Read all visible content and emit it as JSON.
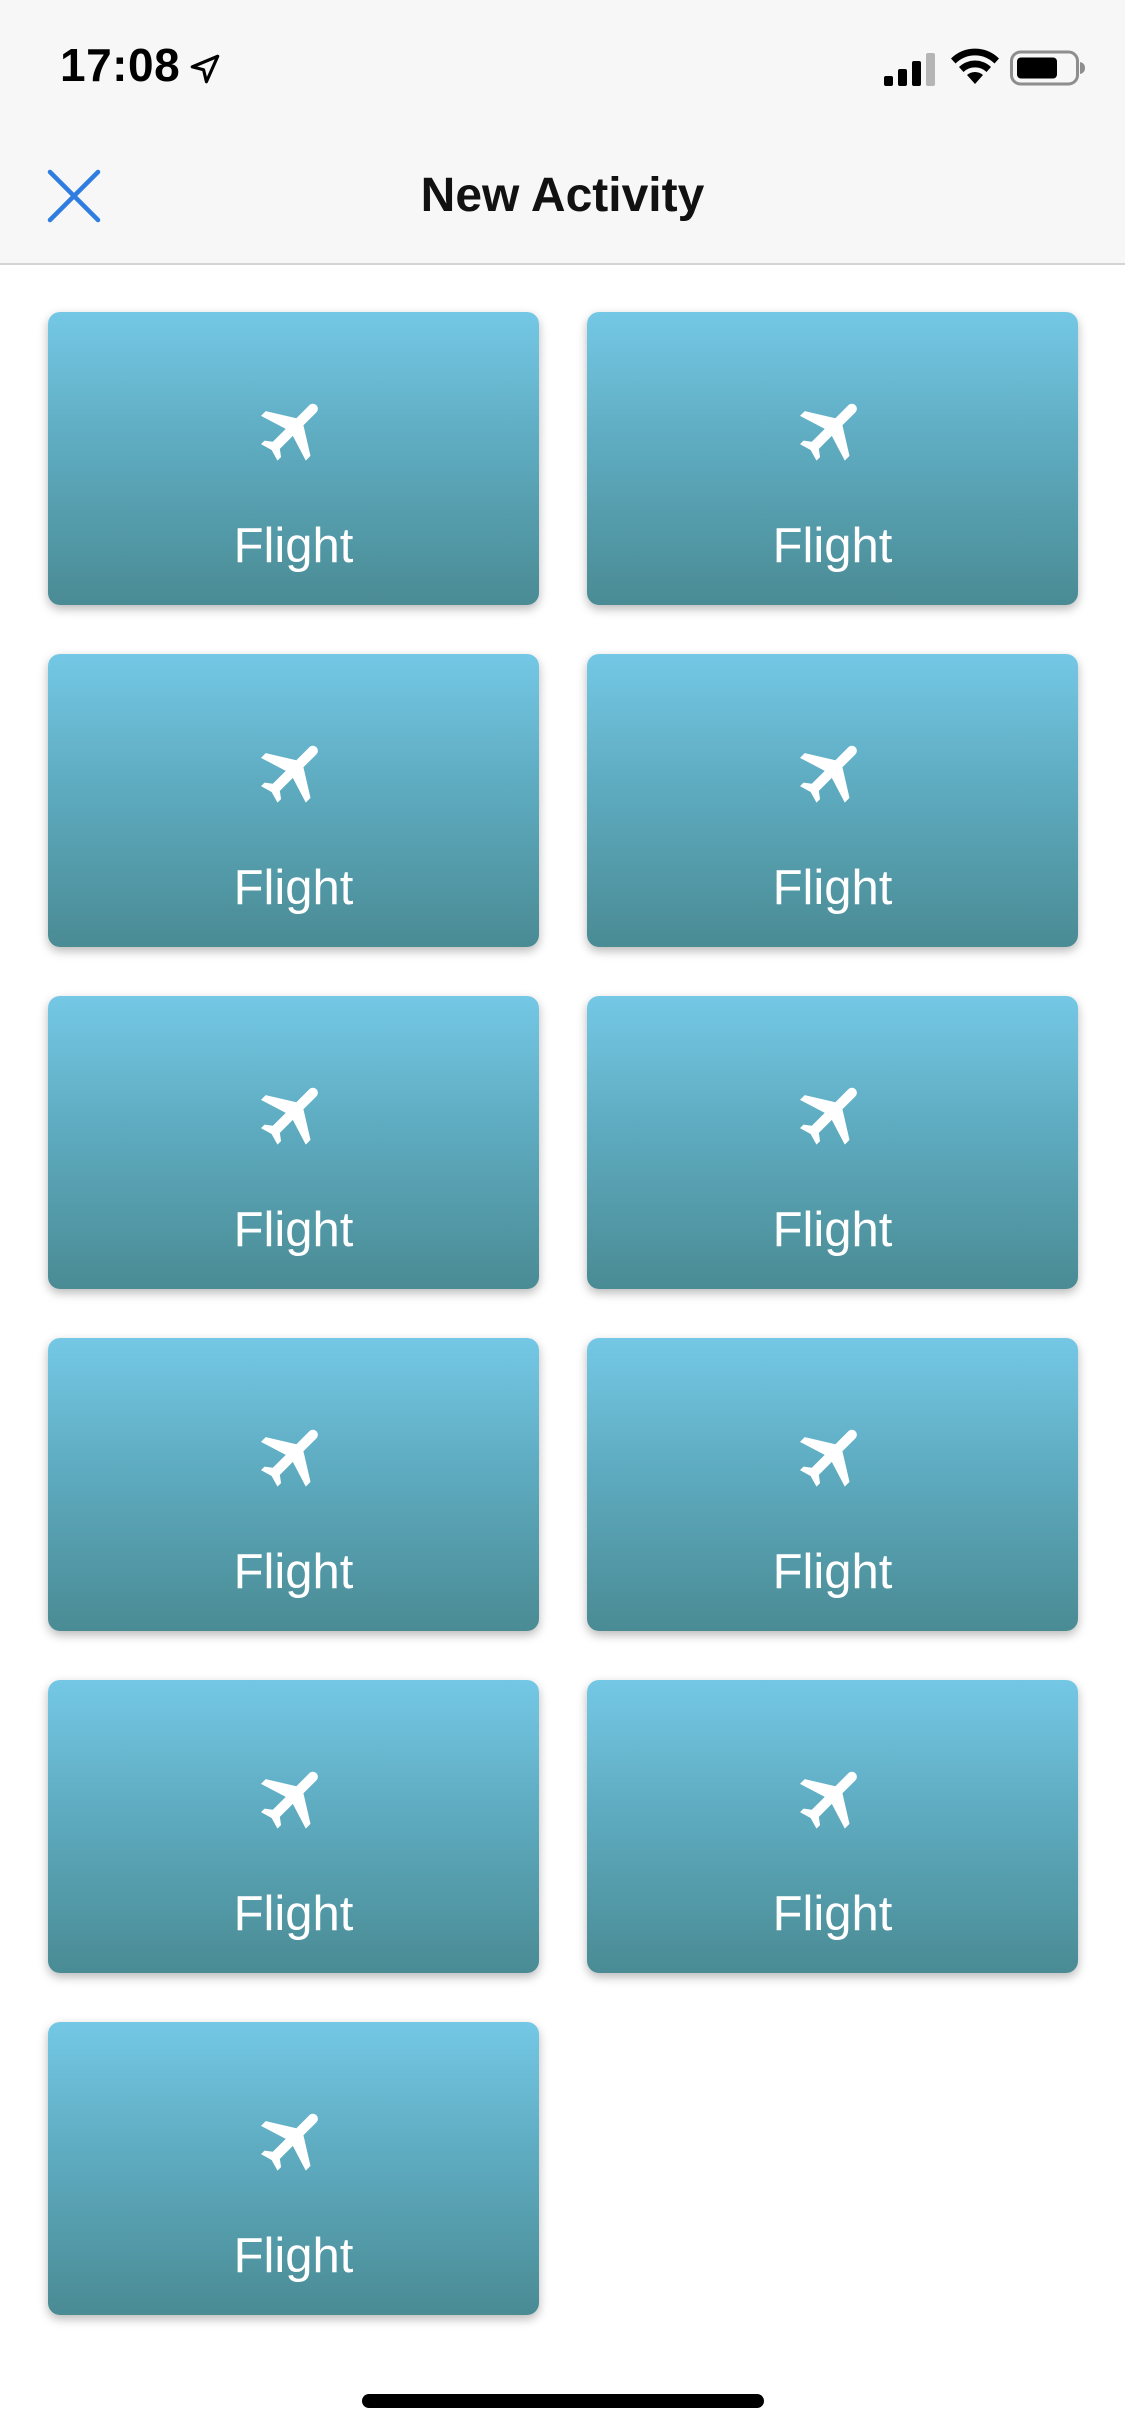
{
  "status_bar": {
    "time": "17:08",
    "icons": [
      "location-arrow-icon",
      "cellular-signal-icon",
      "wifi-icon",
      "battery-icon"
    ]
  },
  "nav": {
    "title": "New Activity",
    "close_icon": "close-icon",
    "accent_color": "#2f7de1"
  },
  "tiles": [
    {
      "label": "Flight",
      "icon": "airplane-icon"
    },
    {
      "label": "Flight",
      "icon": "airplane-icon"
    },
    {
      "label": "Flight",
      "icon": "airplane-icon"
    },
    {
      "label": "Flight",
      "icon": "airplane-icon"
    },
    {
      "label": "Flight",
      "icon": "airplane-icon"
    },
    {
      "label": "Flight",
      "icon": "airplane-icon"
    },
    {
      "label": "Flight",
      "icon": "airplane-icon"
    },
    {
      "label": "Flight",
      "icon": "airplane-icon"
    },
    {
      "label": "Flight",
      "icon": "airplane-icon"
    },
    {
      "label": "Flight",
      "icon": "airplane-icon"
    },
    {
      "label": "Flight",
      "icon": "airplane-icon"
    }
  ],
  "colors": {
    "tile_gradient_top": "#74c8e5",
    "tile_gradient_bottom": "#4a8b94",
    "tile_text": "#ffffff"
  }
}
